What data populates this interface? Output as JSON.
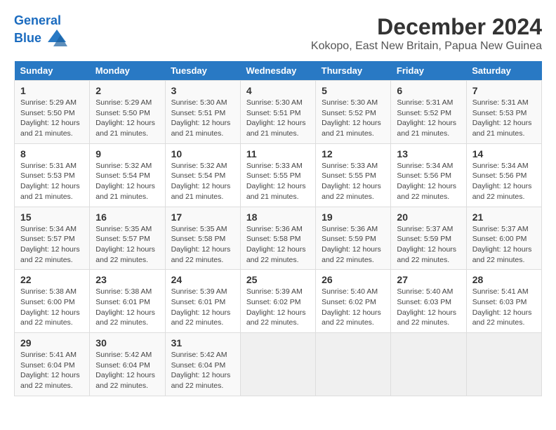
{
  "logo": {
    "general": "General",
    "blue": "Blue"
  },
  "title": "December 2024",
  "subtitle": "Kokopo, East New Britain, Papua New Guinea",
  "days_header": [
    "Sunday",
    "Monday",
    "Tuesday",
    "Wednesday",
    "Thursday",
    "Friday",
    "Saturday"
  ],
  "weeks": [
    [
      {
        "day": "1",
        "sunrise": "Sunrise: 5:29 AM",
        "sunset": "Sunset: 5:50 PM",
        "daylight": "Daylight: 12 hours and 21 minutes."
      },
      {
        "day": "2",
        "sunrise": "Sunrise: 5:29 AM",
        "sunset": "Sunset: 5:50 PM",
        "daylight": "Daylight: 12 hours and 21 minutes."
      },
      {
        "day": "3",
        "sunrise": "Sunrise: 5:30 AM",
        "sunset": "Sunset: 5:51 PM",
        "daylight": "Daylight: 12 hours and 21 minutes."
      },
      {
        "day": "4",
        "sunrise": "Sunrise: 5:30 AM",
        "sunset": "Sunset: 5:51 PM",
        "daylight": "Daylight: 12 hours and 21 minutes."
      },
      {
        "day": "5",
        "sunrise": "Sunrise: 5:30 AM",
        "sunset": "Sunset: 5:52 PM",
        "daylight": "Daylight: 12 hours and 21 minutes."
      },
      {
        "day": "6",
        "sunrise": "Sunrise: 5:31 AM",
        "sunset": "Sunset: 5:52 PM",
        "daylight": "Daylight: 12 hours and 21 minutes."
      },
      {
        "day": "7",
        "sunrise": "Sunrise: 5:31 AM",
        "sunset": "Sunset: 5:53 PM",
        "daylight": "Daylight: 12 hours and 21 minutes."
      }
    ],
    [
      {
        "day": "8",
        "sunrise": "Sunrise: 5:31 AM",
        "sunset": "Sunset: 5:53 PM",
        "daylight": "Daylight: 12 hours and 21 minutes."
      },
      {
        "day": "9",
        "sunrise": "Sunrise: 5:32 AM",
        "sunset": "Sunset: 5:54 PM",
        "daylight": "Daylight: 12 hours and 21 minutes."
      },
      {
        "day": "10",
        "sunrise": "Sunrise: 5:32 AM",
        "sunset": "Sunset: 5:54 PM",
        "daylight": "Daylight: 12 hours and 21 minutes."
      },
      {
        "day": "11",
        "sunrise": "Sunrise: 5:33 AM",
        "sunset": "Sunset: 5:55 PM",
        "daylight": "Daylight: 12 hours and 21 minutes."
      },
      {
        "day": "12",
        "sunrise": "Sunrise: 5:33 AM",
        "sunset": "Sunset: 5:55 PM",
        "daylight": "Daylight: 12 hours and 22 minutes."
      },
      {
        "day": "13",
        "sunrise": "Sunrise: 5:34 AM",
        "sunset": "Sunset: 5:56 PM",
        "daylight": "Daylight: 12 hours and 22 minutes."
      },
      {
        "day": "14",
        "sunrise": "Sunrise: 5:34 AM",
        "sunset": "Sunset: 5:56 PM",
        "daylight": "Daylight: 12 hours and 22 minutes."
      }
    ],
    [
      {
        "day": "15",
        "sunrise": "Sunrise: 5:34 AM",
        "sunset": "Sunset: 5:57 PM",
        "daylight": "Daylight: 12 hours and 22 minutes."
      },
      {
        "day": "16",
        "sunrise": "Sunrise: 5:35 AM",
        "sunset": "Sunset: 5:57 PM",
        "daylight": "Daylight: 12 hours and 22 minutes."
      },
      {
        "day": "17",
        "sunrise": "Sunrise: 5:35 AM",
        "sunset": "Sunset: 5:58 PM",
        "daylight": "Daylight: 12 hours and 22 minutes."
      },
      {
        "day": "18",
        "sunrise": "Sunrise: 5:36 AM",
        "sunset": "Sunset: 5:58 PM",
        "daylight": "Daylight: 12 hours and 22 minutes."
      },
      {
        "day": "19",
        "sunrise": "Sunrise: 5:36 AM",
        "sunset": "Sunset: 5:59 PM",
        "daylight": "Daylight: 12 hours and 22 minutes."
      },
      {
        "day": "20",
        "sunrise": "Sunrise: 5:37 AM",
        "sunset": "Sunset: 5:59 PM",
        "daylight": "Daylight: 12 hours and 22 minutes."
      },
      {
        "day": "21",
        "sunrise": "Sunrise: 5:37 AM",
        "sunset": "Sunset: 6:00 PM",
        "daylight": "Daylight: 12 hours and 22 minutes."
      }
    ],
    [
      {
        "day": "22",
        "sunrise": "Sunrise: 5:38 AM",
        "sunset": "Sunset: 6:00 PM",
        "daylight": "Daylight: 12 hours and 22 minutes."
      },
      {
        "day": "23",
        "sunrise": "Sunrise: 5:38 AM",
        "sunset": "Sunset: 6:01 PM",
        "daylight": "Daylight: 12 hours and 22 minutes."
      },
      {
        "day": "24",
        "sunrise": "Sunrise: 5:39 AM",
        "sunset": "Sunset: 6:01 PM",
        "daylight": "Daylight: 12 hours and 22 minutes."
      },
      {
        "day": "25",
        "sunrise": "Sunrise: 5:39 AM",
        "sunset": "Sunset: 6:02 PM",
        "daylight": "Daylight: 12 hours and 22 minutes."
      },
      {
        "day": "26",
        "sunrise": "Sunrise: 5:40 AM",
        "sunset": "Sunset: 6:02 PM",
        "daylight": "Daylight: 12 hours and 22 minutes."
      },
      {
        "day": "27",
        "sunrise": "Sunrise: 5:40 AM",
        "sunset": "Sunset: 6:03 PM",
        "daylight": "Daylight: 12 hours and 22 minutes."
      },
      {
        "day": "28",
        "sunrise": "Sunrise: 5:41 AM",
        "sunset": "Sunset: 6:03 PM",
        "daylight": "Daylight: 12 hours and 22 minutes."
      }
    ],
    [
      {
        "day": "29",
        "sunrise": "Sunrise: 5:41 AM",
        "sunset": "Sunset: 6:04 PM",
        "daylight": "Daylight: 12 hours and 22 minutes."
      },
      {
        "day": "30",
        "sunrise": "Sunrise: 5:42 AM",
        "sunset": "Sunset: 6:04 PM",
        "daylight": "Daylight: 12 hours and 22 minutes."
      },
      {
        "day": "31",
        "sunrise": "Sunrise: 5:42 AM",
        "sunset": "Sunset: 6:04 PM",
        "daylight": "Daylight: 12 hours and 22 minutes."
      },
      null,
      null,
      null,
      null
    ]
  ]
}
